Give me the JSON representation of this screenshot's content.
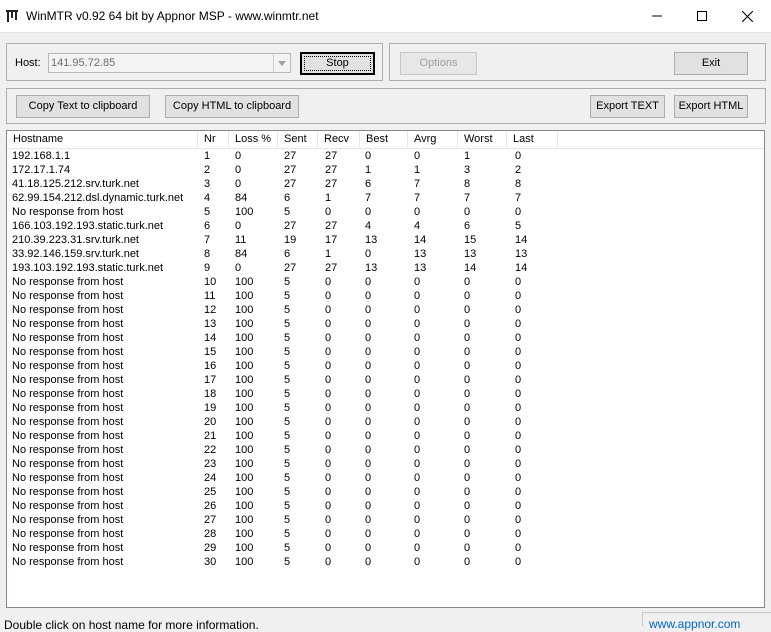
{
  "window": {
    "title": "WinMTR v0.92 64 bit by Appnor MSP - www.winmtr.net"
  },
  "host": {
    "label": "Host:",
    "value": "141.95.72.85",
    "stop_label": "Stop"
  },
  "toolbar": {
    "options_label": "Options",
    "exit_label": "Exit",
    "copy_text_label": "Copy Text to clipboard",
    "copy_html_label": "Copy HTML to clipboard",
    "export_text_label": "Export TEXT",
    "export_html_label": "Export HTML"
  },
  "table": {
    "columns": [
      "Hostname",
      "Nr",
      "Loss %",
      "Sent",
      "Recv",
      "Best",
      "Avrg",
      "Worst",
      "Last"
    ],
    "rows": [
      [
        "192.168.1.1",
        "1",
        "0",
        "27",
        "27",
        "0",
        "0",
        "1",
        "0"
      ],
      [
        "172.17.1.74",
        "2",
        "0",
        "27",
        "27",
        "1",
        "1",
        "3",
        "2"
      ],
      [
        "41.18.125.212.srv.turk.net",
        "3",
        "0",
        "27",
        "27",
        "6",
        "7",
        "8",
        "8"
      ],
      [
        "62.99.154.212.dsl.dynamic.turk.net",
        "4",
        "84",
        "6",
        "1",
        "7",
        "7",
        "7",
        "7"
      ],
      [
        "No response from host",
        "5",
        "100",
        "5",
        "0",
        "0",
        "0",
        "0",
        "0"
      ],
      [
        "166.103.192.193.static.turk.net",
        "6",
        "0",
        "27",
        "27",
        "4",
        "4",
        "6",
        "5"
      ],
      [
        "210.39.223.31.srv.turk.net",
        "7",
        "11",
        "19",
        "17",
        "13",
        "14",
        "15",
        "14"
      ],
      [
        "33.92.146.159.srv.turk.net",
        "8",
        "84",
        "6",
        "1",
        "0",
        "13",
        "13",
        "13"
      ],
      [
        "193.103.192.193.static.turk.net",
        "9",
        "0",
        "27",
        "27",
        "13",
        "13",
        "14",
        "14"
      ],
      [
        "No response from host",
        "10",
        "100",
        "5",
        "0",
        "0",
        "0",
        "0",
        "0"
      ],
      [
        "No response from host",
        "11",
        "100",
        "5",
        "0",
        "0",
        "0",
        "0",
        "0"
      ],
      [
        "No response from host",
        "12",
        "100",
        "5",
        "0",
        "0",
        "0",
        "0",
        "0"
      ],
      [
        "No response from host",
        "13",
        "100",
        "5",
        "0",
        "0",
        "0",
        "0",
        "0"
      ],
      [
        "No response from host",
        "14",
        "100",
        "5",
        "0",
        "0",
        "0",
        "0",
        "0"
      ],
      [
        "No response from host",
        "15",
        "100",
        "5",
        "0",
        "0",
        "0",
        "0",
        "0"
      ],
      [
        "No response from host",
        "16",
        "100",
        "5",
        "0",
        "0",
        "0",
        "0",
        "0"
      ],
      [
        "No response from host",
        "17",
        "100",
        "5",
        "0",
        "0",
        "0",
        "0",
        "0"
      ],
      [
        "No response from host",
        "18",
        "100",
        "5",
        "0",
        "0",
        "0",
        "0",
        "0"
      ],
      [
        "No response from host",
        "19",
        "100",
        "5",
        "0",
        "0",
        "0",
        "0",
        "0"
      ],
      [
        "No response from host",
        "20",
        "100",
        "5",
        "0",
        "0",
        "0",
        "0",
        "0"
      ],
      [
        "No response from host",
        "21",
        "100",
        "5",
        "0",
        "0",
        "0",
        "0",
        "0"
      ],
      [
        "No response from host",
        "22",
        "100",
        "5",
        "0",
        "0",
        "0",
        "0",
        "0"
      ],
      [
        "No response from host",
        "23",
        "100",
        "5",
        "0",
        "0",
        "0",
        "0",
        "0"
      ],
      [
        "No response from host",
        "24",
        "100",
        "5",
        "0",
        "0",
        "0",
        "0",
        "0"
      ],
      [
        "No response from host",
        "25",
        "100",
        "5",
        "0",
        "0",
        "0",
        "0",
        "0"
      ],
      [
        "No response from host",
        "26",
        "100",
        "5",
        "0",
        "0",
        "0",
        "0",
        "0"
      ],
      [
        "No response from host",
        "27",
        "100",
        "5",
        "0",
        "0",
        "0",
        "0",
        "0"
      ],
      [
        "No response from host",
        "28",
        "100",
        "5",
        "0",
        "0",
        "0",
        "0",
        "0"
      ],
      [
        "No response from host",
        "29",
        "100",
        "5",
        "0",
        "0",
        "0",
        "0",
        "0"
      ],
      [
        "No response from host",
        "30",
        "100",
        "5",
        "0",
        "0",
        "0",
        "0",
        "0"
      ]
    ]
  },
  "status": {
    "text": "Double click on host name for more information.",
    "link": "www.appnor.com"
  },
  "colors": {
    "link": "#0066cc",
    "disabled_text": "#a0a0a0"
  },
  "icons": {
    "app": "winmtr-app-icon",
    "minimize": "minimize-icon",
    "maximize": "maximize-icon",
    "close": "close-icon",
    "dropdown": "chevron-down-icon"
  }
}
